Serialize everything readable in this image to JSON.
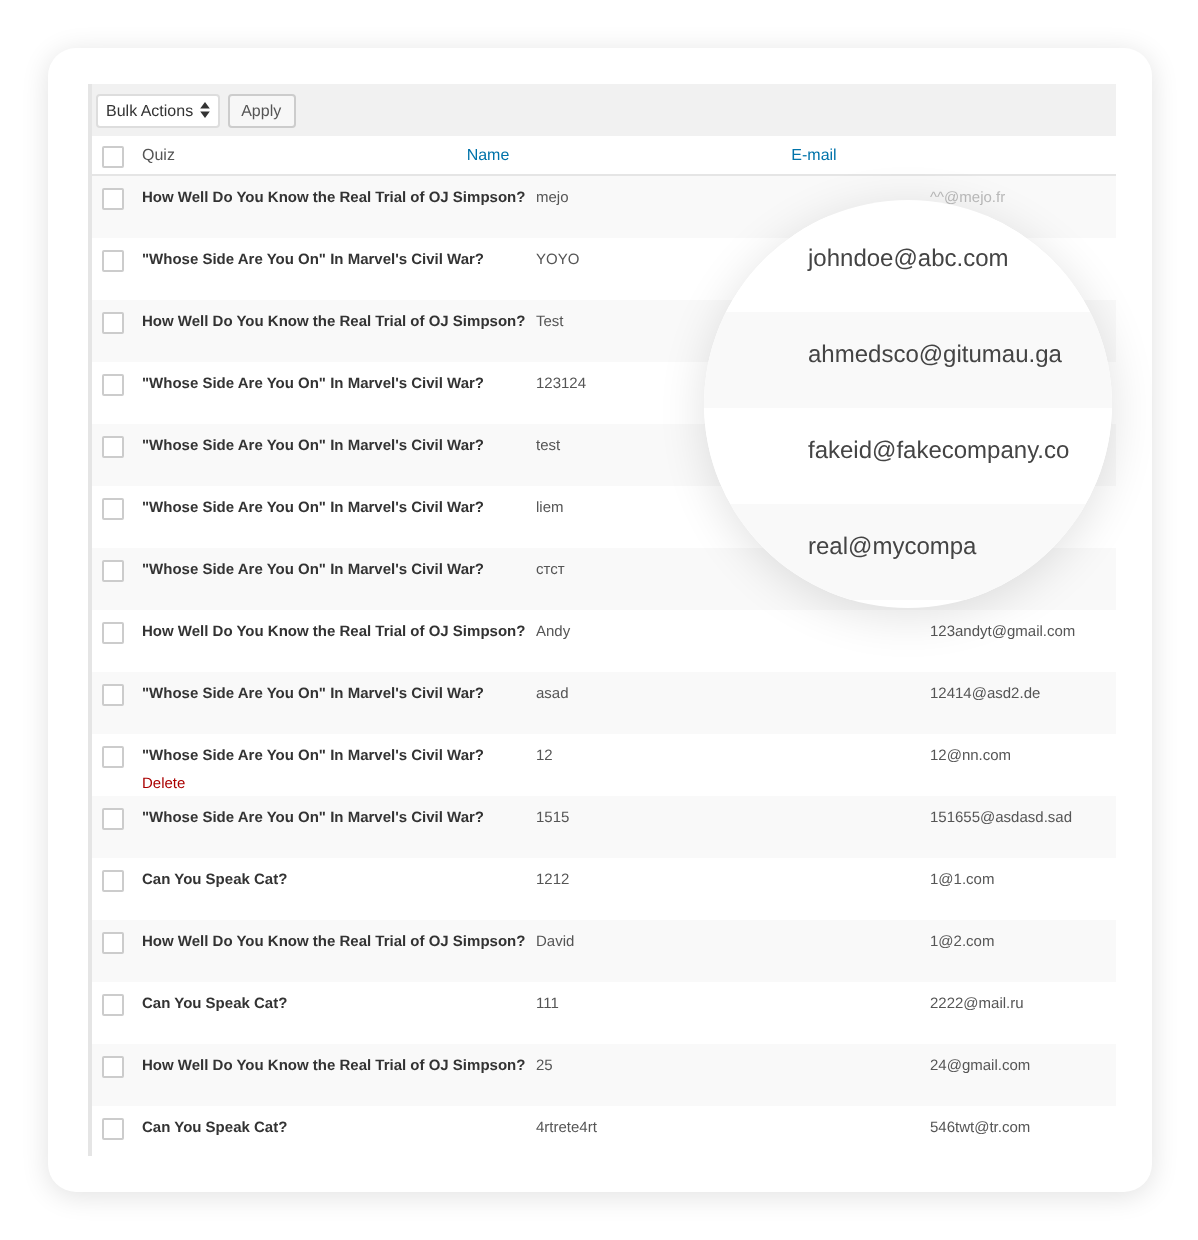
{
  "toolbar": {
    "bulk_actions": "Bulk Actions",
    "apply": "Apply"
  },
  "select_all": {
    "checked": false
  },
  "columns": [
    {
      "label": "Quiz",
      "sortable": false
    },
    {
      "label": "Name",
      "sortable": true
    },
    {
      "label": "E-mail",
      "sortable": true
    }
  ],
  "rows": [
    {
      "quiz": "How Well Do You Know the Real Trial of OJ Simpson?",
      "name": "mejo",
      "email": "^^@mejo.fr",
      "checked": false
    },
    {
      "quiz": "\"Whose Side Are You On\" In Marvel's Civil War?",
      "name": "YOYO",
      "checked": false
    },
    {
      "quiz": "How Well Do You Know the Real Trial of OJ Simpson?",
      "name": "Test",
      "checked": false
    },
    {
      "quiz": "\"Whose Side Are You On\" In Marvel's Civil War?",
      "name": "123124",
      "checked": false
    },
    {
      "quiz": "\"Whose Side Are You On\" In Marvel's Civil War?",
      "name": "test",
      "checked": false
    },
    {
      "quiz": "\"Whose Side Are You On\" In Marvel's Civil War?",
      "name": "liem",
      "checked": false
    },
    {
      "quiz": "\"Whose Side Are You On\" In Marvel's Civil War?",
      "name": "стст",
      "checked": false
    },
    {
      "quiz": "How Well Do You Know the Real Trial of OJ Simpson?",
      "name": "Andy",
      "email": "123andyt@gmail.com",
      "checked": false
    },
    {
      "quiz": "\"Whose Side Are You On\" In Marvel's Civil War?",
      "name": "asad",
      "email": "12414@asd2.de",
      "checked": false
    },
    {
      "quiz": "\"Whose Side Are You On\" In Marvel's Civil War?",
      "name": "12",
      "email": "12@nn.com",
      "checked": false,
      "row_action": "Delete"
    },
    {
      "quiz": "\"Whose Side Are You On\" In Marvel's Civil War?",
      "name": "1515",
      "email": "151655@asdasd.sad",
      "checked": false
    },
    {
      "quiz": "Can You Speak Cat?",
      "name": "1212",
      "email": "1@1.com",
      "checked": false
    },
    {
      "quiz": "How Well Do You Know the Real Trial of OJ Simpson?",
      "name": "David",
      "email": "1@2.com",
      "checked": false
    },
    {
      "quiz": "Can You Speak Cat?",
      "name": "111",
      "email": "2222@mail.ru",
      "checked": false
    },
    {
      "quiz": "How Well Do You Know the Real Trial of OJ Simpson?",
      "name": "25",
      "email": "24@gmail.com",
      "checked": false
    },
    {
      "quiz": "Can You Speak Cat?",
      "name": "4rtrete4rt",
      "email": "546twt@tr.com",
      "checked": false
    }
  ],
  "magnifier": {
    "emails": [
      "johndoe@abc.com",
      "ahmedsco@gitumau.ga",
      "fakeid@fakecompany.co",
      "real@mycompa"
    ]
  }
}
